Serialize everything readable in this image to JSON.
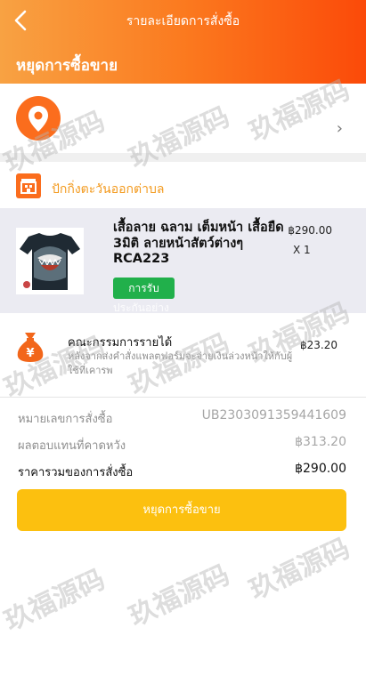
{
  "header": {
    "title": "รายละเอียดการสั่งซื้อ",
    "status": "หยุดการซื้อขาย"
  },
  "shop": {
    "name": "ปักกิ่งตะวันออกต่าบล"
  },
  "product": {
    "title": "เสื้อลาย ฉลาม เต็มหน้า เสื้อยืด 3มิติ ลายหน้าสัตว์ต่างๆ RCA223",
    "price": "฿290.00",
    "quantity": "X 1",
    "guarantee_badge": "การรับ",
    "guarantee_sub": "ประกันอย่าง"
  },
  "commission": {
    "title": "คณะกรรมการรายได้",
    "description": "หลังจากส่งคำสั่งแพลตฟอร์มจะจ่ายเงินล่วงหน้าให้กับผู้ใช้ที่เคารพ",
    "value": "฿23.20"
  },
  "order_info": {
    "order_number_label": "หมายเลขการสั่งซื้อ",
    "order_number_value": "UB2303091359441609",
    "expected_return_label": "ผลตอบแทนที่คาดหวัง",
    "expected_return_value": "฿313.20",
    "total_label": "ราคารวมของการสั่งซื้อ",
    "total_value": "฿290.00"
  },
  "actions": {
    "stop_trading_label": "หยุดการซื้อขาย"
  },
  "watermark": "玖福源码",
  "colors": {
    "header_gradient_start": "#f8a243",
    "header_gradient_end": "#fb4a09",
    "accent_orange": "#f39a1e",
    "badge_green": "#21b04b",
    "button_yellow": "#fcc00f"
  },
  "icons": [
    "back-chevron-icon",
    "location-pin-icon",
    "chevron-right-icon",
    "shop-icon",
    "money-bag-icon"
  ]
}
